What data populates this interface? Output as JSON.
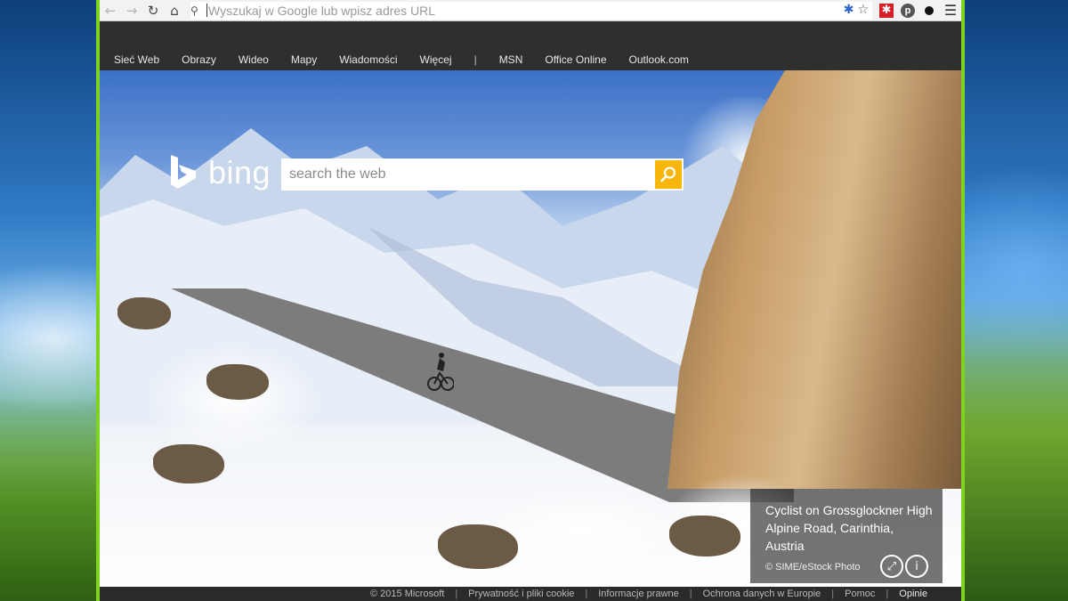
{
  "browser": {
    "back_icon": "back-arrow-icon",
    "forward_icon": "forward-arrow-icon",
    "reload_icon": "reload-icon",
    "home_icon": "home-icon",
    "omnibox_placeholder": "Wyszukaj w Google lub wpisz adres URL",
    "star_icon": "bookmark-star-icon",
    "menu_icon": "hamburger-menu-icon"
  },
  "bing_nav": {
    "links": [
      "Sieć Web",
      "Obrazy",
      "Wideo",
      "Mapy",
      "Wiadomości",
      "Więcej"
    ],
    "separator": "|",
    "extra_links": [
      "MSN",
      "Office Online",
      "Outlook.com"
    ]
  },
  "brand": {
    "wordmark": "bing"
  },
  "search": {
    "placeholder": "search the web"
  },
  "caption": {
    "title": "Cyclist on Grossglockner High Alpine Road, Carinthia, Austria",
    "credit": "© SIME/eStock Photo"
  },
  "footer": {
    "items": [
      "© 2015 Microsoft",
      "Prywatność i pliki cookie",
      "Informacje prawne",
      "Ochrona danych w Europie",
      "Pomoc",
      "Opinie"
    ]
  },
  "colors": {
    "accent_green": "#7ed321",
    "search_button": "#f8b50c",
    "bing_nav_bg": "#2f2f2f"
  }
}
